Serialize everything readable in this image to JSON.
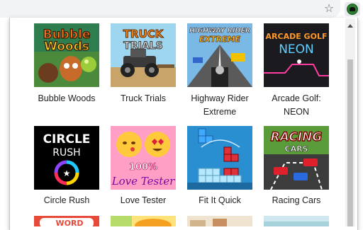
{
  "toolbar": {
    "star_icon": "star-outline-icon",
    "extension_icon": "game-controller-icon"
  },
  "games": [
    {
      "title": "Bubble Woods",
      "thumb_text": [
        "Bubble",
        "Woods"
      ]
    },
    {
      "title": "Truck Trials",
      "thumb_text": [
        "TRUCK",
        "TRIALS"
      ]
    },
    {
      "title": "Highway Rider Extreme",
      "title_lines": [
        "Highway Rider",
        "Extreme"
      ],
      "thumb_text": [
        "HIGHWAY RIDER",
        "EXTREME"
      ]
    },
    {
      "title": "Arcade Golf: NEON",
      "title_lines": [
        "Arcade Golf:",
        "NEON"
      ],
      "thumb_text": [
        "ARCADE GOLF",
        "NEON"
      ]
    },
    {
      "title": "Circle Rush",
      "thumb_text": [
        "CIRCLE",
        "RUSH"
      ]
    },
    {
      "title": "Love Tester",
      "thumb_text": [
        "100%",
        "Love Tester"
      ]
    },
    {
      "title": "Fit It Quick"
    },
    {
      "title": "Racing Cars",
      "thumb_text": [
        "RACING",
        "CARS"
      ]
    }
  ],
  "partial_row": [
    {
      "thumb_text": "WORD"
    },
    {
      "thumb_text": ""
    },
    {
      "thumb_text": ""
    },
    {
      "thumb_text": ""
    }
  ],
  "colors": {
    "extension_green": "#2e7d32",
    "label_text": "#222222"
  }
}
